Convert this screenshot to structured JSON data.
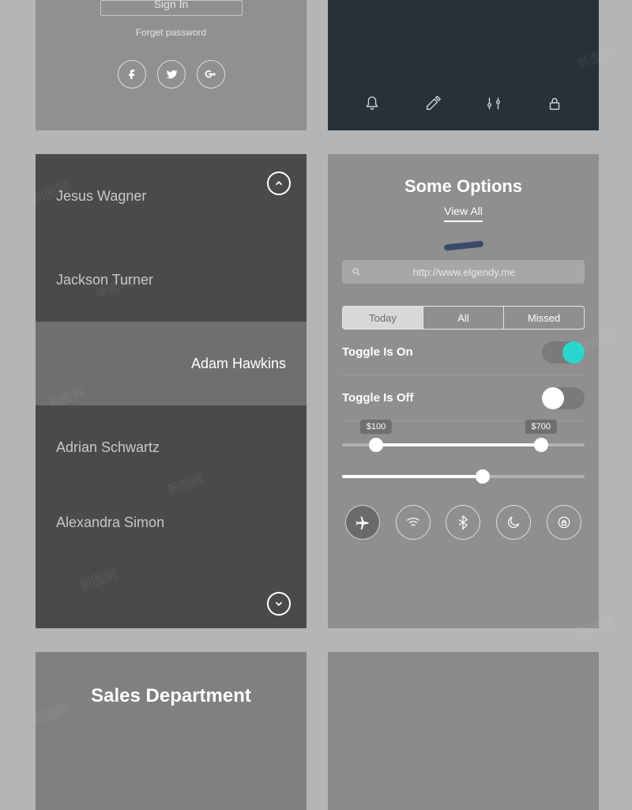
{
  "signin": {
    "button_label": "Sign In",
    "forget_label": "Forget password"
  },
  "contacts": {
    "items": [
      {
        "name": "Jesus Wagner",
        "selected": false
      },
      {
        "name": "Jackson Turner",
        "selected": false
      },
      {
        "name": "Adam Hawkins",
        "selected": true
      },
      {
        "name": "Adrian Schwartz",
        "selected": false
      },
      {
        "name": "Alexandra Simon",
        "selected": false
      }
    ]
  },
  "options": {
    "title": "Some Options",
    "view_all": "View All",
    "search_value": "http://www.elgendy.me",
    "segments": [
      "Today",
      "All",
      "Missed"
    ],
    "segment_active": 0,
    "toggles": [
      {
        "label": "Toggle Is On",
        "on": true
      },
      {
        "label": "Toggle Is Off",
        "on": false
      }
    ],
    "range_slider": {
      "min_label": "$100",
      "max_label": "$700",
      "min_pct": 14,
      "max_pct": 82
    },
    "single_slider": {
      "pct": 58
    },
    "controls": [
      "airplane",
      "wifi",
      "bluetooth",
      "moon",
      "rotation-lock"
    ],
    "control_active": 0
  },
  "sales": {
    "title": "Sales Department"
  },
  "watermark": "新图网"
}
